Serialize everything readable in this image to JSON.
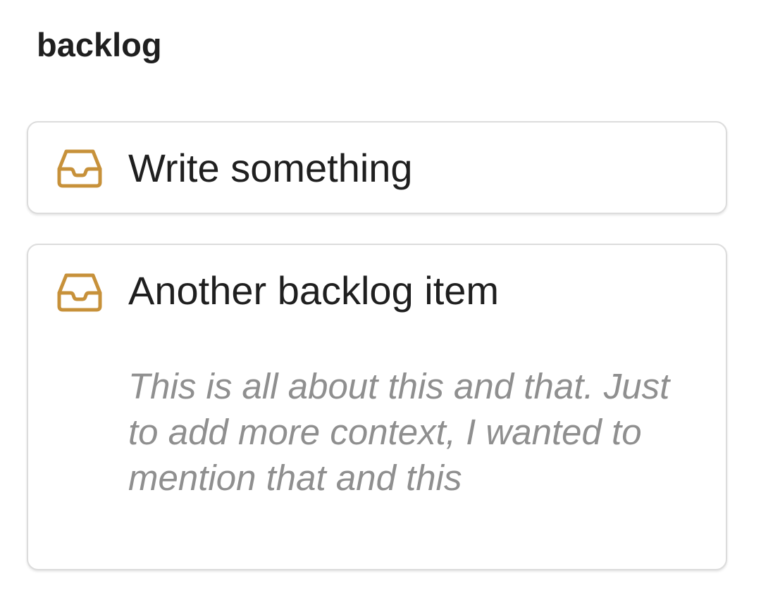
{
  "section": {
    "title": "backlog"
  },
  "colors": {
    "icon_accent": "#c7913a",
    "card_border": "#dcdcdc",
    "title_text": "#1f1f1f",
    "description_text": "#8f8f8f"
  },
  "items": [
    {
      "icon": "inbox-tray-icon",
      "title": "Write something",
      "description": ""
    },
    {
      "icon": "inbox-tray-icon",
      "title": "Another backlog item",
      "description": "This is all about this and that. Just to add more context, I wanted to mention that and this"
    }
  ]
}
